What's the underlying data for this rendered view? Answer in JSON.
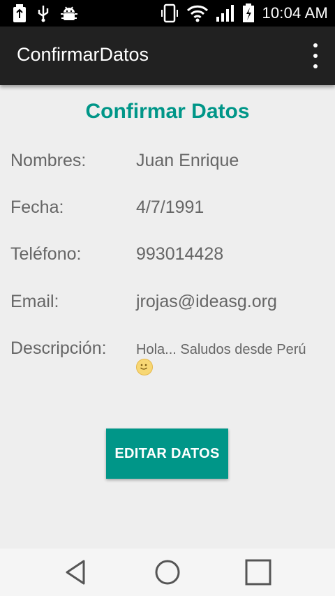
{
  "status_bar": {
    "time": "10:04 AM",
    "icons": [
      "usb-icon",
      "usb-debug-icon",
      "android-debug-icon",
      "vibrate-icon",
      "wifi-icon",
      "signal-icon",
      "battery-charging-icon"
    ]
  },
  "app_bar": {
    "title": "ConfirmarDatos",
    "overflow_icon": "more-vertical-icon"
  },
  "main": {
    "heading": "Confirmar Datos",
    "fields": [
      {
        "label": "Nombres:",
        "value": "Juan Enrique"
      },
      {
        "label": "Fecha:",
        "value": "4/7/1991"
      },
      {
        "label": "Teléfono:",
        "value": "993014428"
      },
      {
        "label": "Email:",
        "value": "jrojas@ideasg.org"
      },
      {
        "label": "Descripción:",
        "value": "Hola... Saludos desde Perú"
      }
    ],
    "edit_button": "EDITAR DATOS"
  },
  "colors": {
    "accent": "#009688",
    "app_bar": "#212121",
    "background": "#eeeeee"
  },
  "nav_bar": {
    "icons": [
      "back-icon",
      "home-icon",
      "recents-icon"
    ]
  }
}
